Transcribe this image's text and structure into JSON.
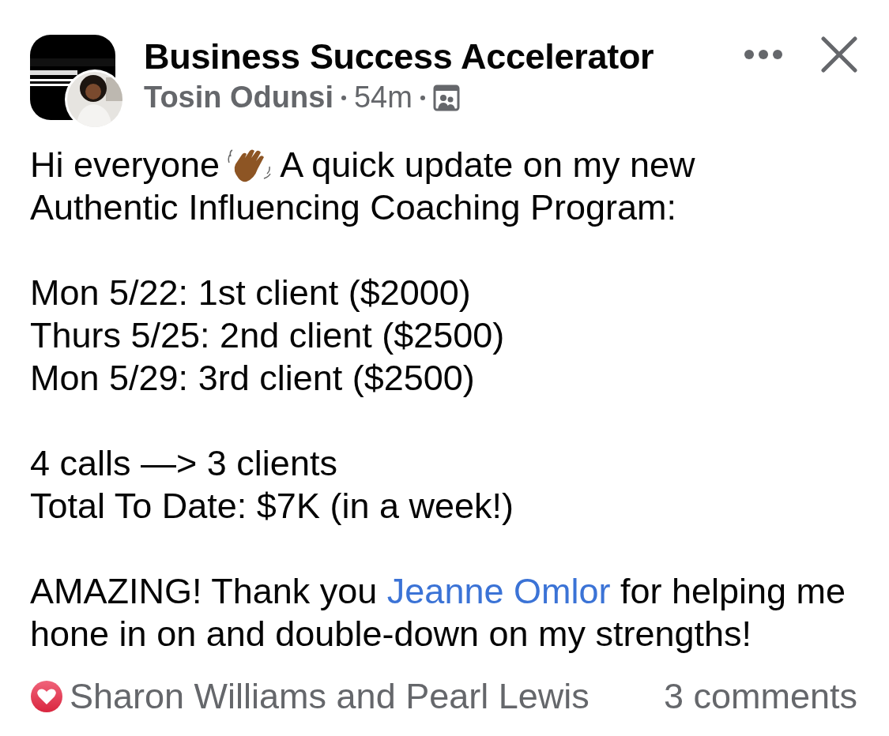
{
  "post": {
    "group_name": "Business Success Accelerator",
    "author": "Tosin Odunsi",
    "time": "54m",
    "intro": {
      "before_emoji": "Hi everyone",
      "after_emoji": "A quick update on my new",
      "second_line": "Authentic Influencing Coaching Program:"
    },
    "paragraphs": [
      {
        "lines": [
          "Mon 5/22: 1st client ($2000)",
          "Thurs 5/25: 2nd client ($2500)",
          "Mon 5/29: 3rd client ($2500)"
        ]
      },
      {
        "lines": [
          "4 calls —> 3 clients",
          "Total To Date: $7K (in a week!)"
        ]
      }
    ],
    "closing": {
      "before_mention": "AMAZING! Thank you ",
      "mention": "Jeanne Omlor",
      "after_mention": " for helping me hone in on and double-down on my strengths!"
    },
    "reactions": "Sharon Williams and Pearl Lewis",
    "comments": "3 comments"
  }
}
